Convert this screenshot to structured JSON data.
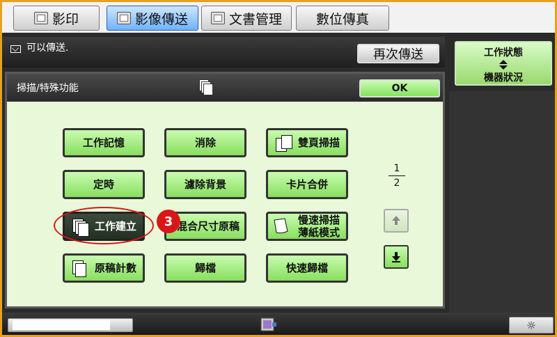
{
  "tabs": [
    {
      "label": "影印"
    },
    {
      "label": "影像傳送"
    },
    {
      "label": "文書管理"
    },
    {
      "label": "數位傳真"
    }
  ],
  "message": {
    "text": "可以傳送."
  },
  "resend_label": "再次傳送",
  "status": {
    "line1": "工作狀態",
    "line2": "機器狀況"
  },
  "panel": {
    "title": "掃描/特殊功能",
    "ok_label": "OK"
  },
  "functions": [
    {
      "label": "工作記憶"
    },
    {
      "label": "消除"
    },
    {
      "label": "雙頁掃描"
    },
    {
      "label": "定時"
    },
    {
      "label": "濾除背景"
    },
    {
      "label": "卡片合併"
    },
    {
      "label": "工作建立"
    },
    {
      "label": "混合尺寸原稿"
    },
    {
      "label": "慢速掃描薄紙模式"
    },
    {
      "label": "原稿計數"
    },
    {
      "label": "歸檔"
    },
    {
      "label": "快速歸檔"
    }
  ],
  "pager": {
    "current": "1",
    "total": "2"
  },
  "step_number": "3",
  "colors": {
    "accent_green": "#88de5e",
    "highlight_red": "#d81818",
    "frame_orange": "#e8a020"
  }
}
